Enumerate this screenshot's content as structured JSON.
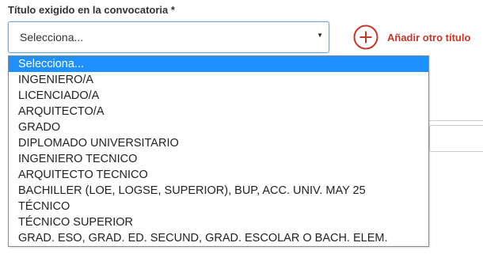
{
  "form": {
    "field_label": "Título exigido en la convocatoria *",
    "select": {
      "selected_value": "Selecciona...",
      "caret_icon": "caret-down-icon"
    },
    "add_button": {
      "icon": "plus-circle-icon",
      "label": "Añadir otro título"
    },
    "dropdown": {
      "selected_index": 0,
      "options": [
        "Selecciona...",
        "INGENIERO/A",
        "LICENCIADO/A",
        "ARQUITECTO/A",
        "GRADO",
        "DIPLOMADO UNIVERSITARIO",
        "INGENIERO TECNICO",
        "ARQUITECTO TECNICO",
        "BACHILLER (LOE, LOGSE, SUPERIOR), BUP, ACC. UNIV. MAY 25",
        "TÉCNICO",
        "TÉCNICO SUPERIOR",
        "GRAD. ESO, GRAD. ED. SECUND, GRAD. ESCOLAR O BACH. ELEM."
      ]
    }
  },
  "colors": {
    "accent": "#c0392b",
    "highlight": "#1e90ff",
    "focus_border": "#7aa3d4"
  }
}
